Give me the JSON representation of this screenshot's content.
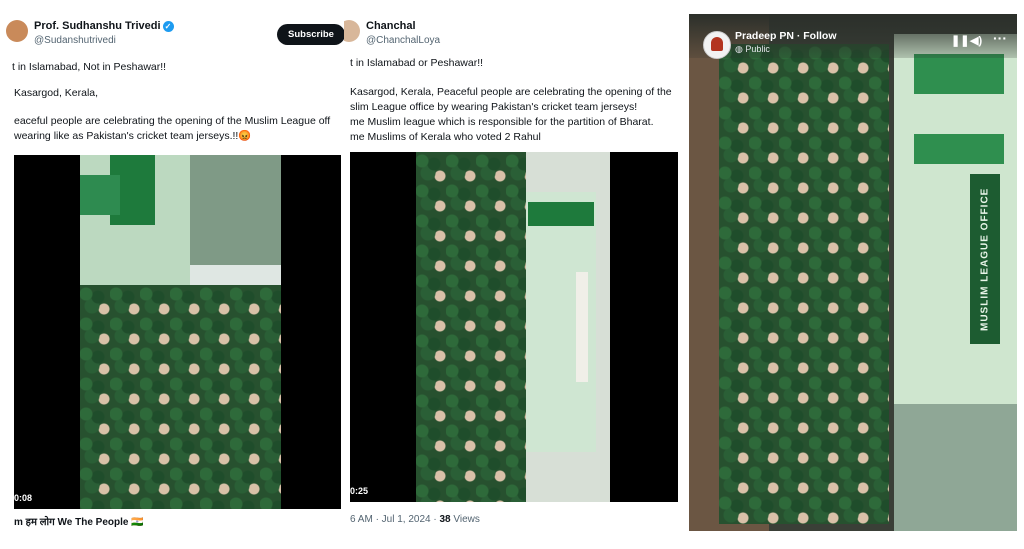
{
  "panel1": {
    "author": {
      "name": "Prof. Sudhanshu Trivedi",
      "handle": "@Sudanshutrivedi"
    },
    "subscribe_label": "Subscribe",
    "tweet_lines": [
      "t in Islamabad, Not in Peshawar!!",
      "Kasargod, Kerala,",
      "eaceful people are celebrating the opening of the Muslim League off",
      " wearing like as Pakistan's cricket team jerseys.!!😡"
    ],
    "video_time": "0:08",
    "footer": "m हम लोग We The People 🇮🇳"
  },
  "panel2": {
    "author": {
      "name": "Chanchal",
      "handle": "@ChanchalLoya"
    },
    "tweet_lines": [
      "t in Islamabad or Peshawar!!",
      "Kasargod, Kerala, Peaceful people are celebrating the opening of the",
      "slim League office by wearing Pakistan's cricket team jerseys!",
      "me Muslim league which is responsible for the partition of Bharat.",
      "me Muslims of Kerala who voted 2 Rahul"
    ],
    "video_time": "0:25",
    "footer": {
      "time": "6 AM · Jul 1, 2024 · ",
      "views_count": "38",
      "views_label": "Views"
    }
  },
  "panel3": {
    "title": "Pradeep PN · Follow",
    "privacy": "Public",
    "sign_text": "MUSLIM LEAGUE OFFICE"
  },
  "colors": {
    "verified": "#1d9bf0",
    "jersey_green": "#1e7a3c",
    "subscribe_bg": "#0f1419"
  },
  "icons": [
    "verified-icon",
    "globe-icon",
    "pause-icon",
    "volume-icon",
    "more-icon"
  ]
}
